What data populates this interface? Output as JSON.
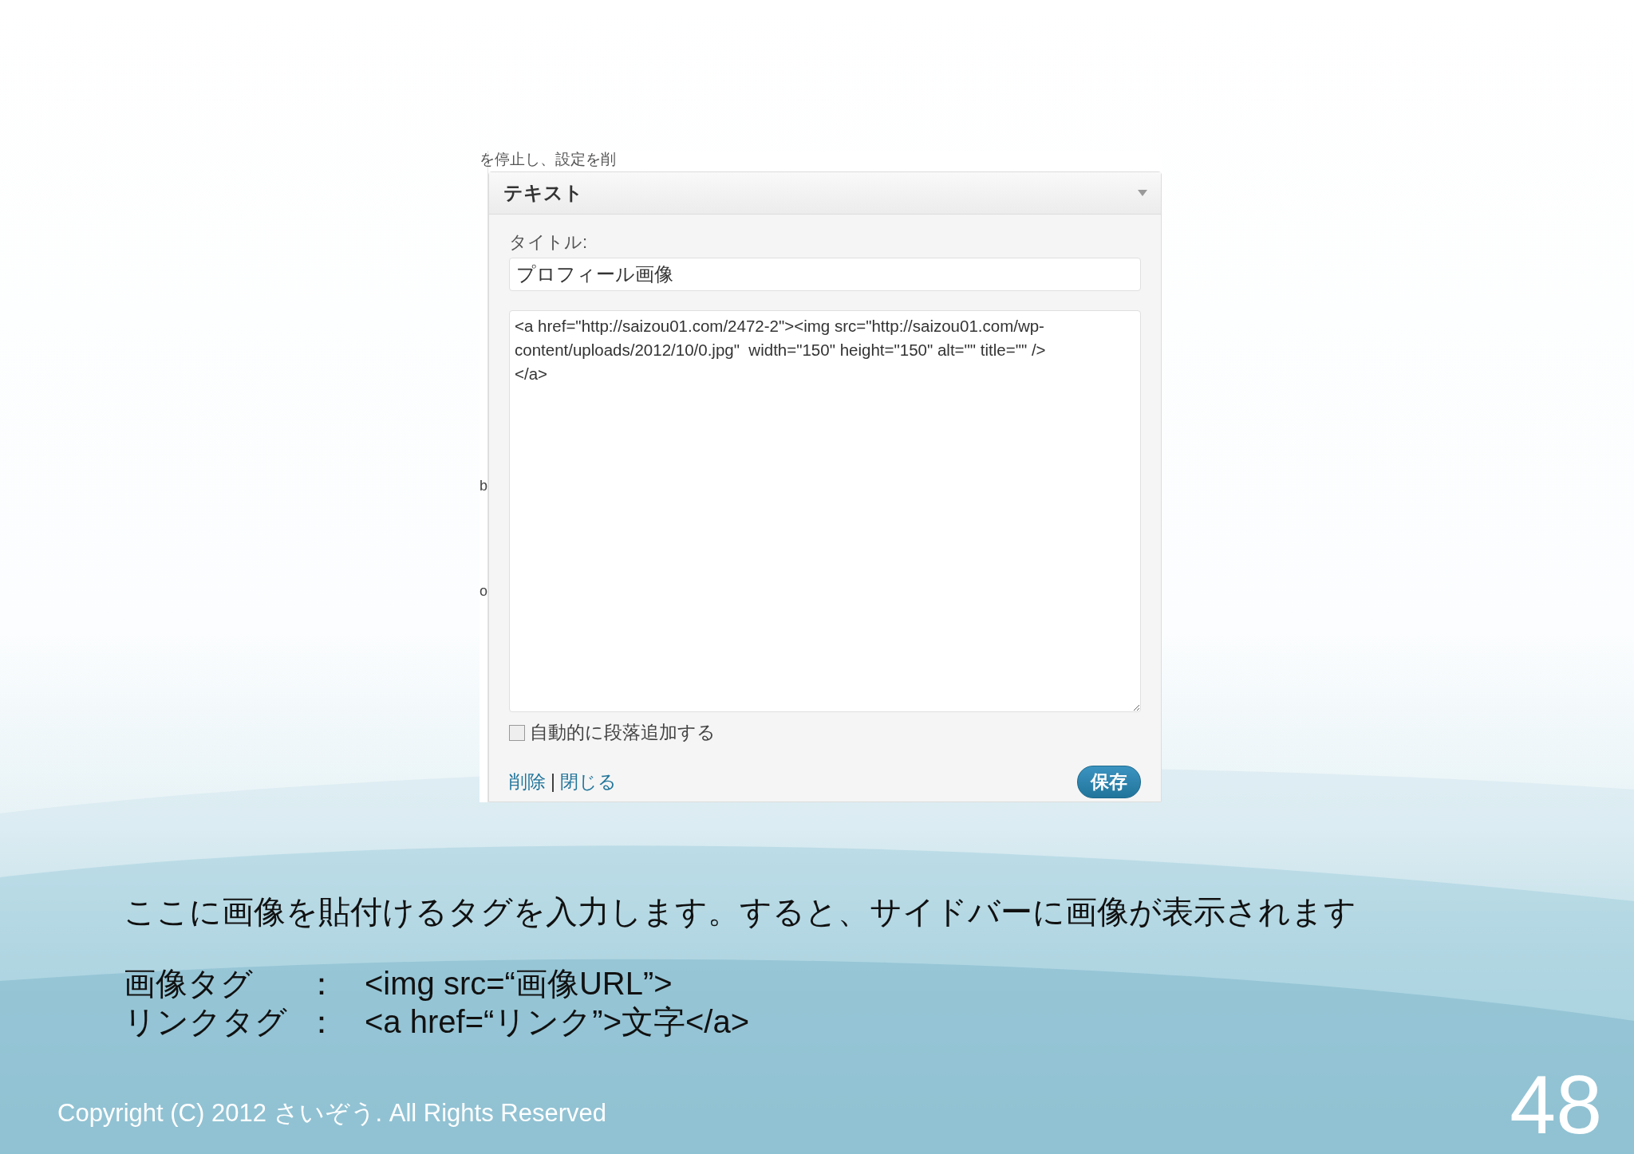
{
  "screenshot": {
    "background_text": "を停止し、設定を削",
    "edge_fragments": [
      "b",
      "o"
    ],
    "widget": {
      "title": "テキスト",
      "title_label": "タイトル:",
      "title_value": "プロフィール画像",
      "content": "<a href=\"http://saizou01.com/2472-2\"><img src=\"http://saizou01.com/wp-content/uploads/2012/10/0.jpg\"  width=\"150\" height=\"150\" alt=\"\" title=\"\" />\n</a>",
      "auto_paragraph": {
        "label": "自動的に段落追加する",
        "checked": false
      },
      "links": [
        "削除",
        "閉じる"
      ],
      "separator": "|",
      "save_button": "保存"
    }
  },
  "description": "ここに画像を貼付けるタグを入力します。すると、サイドバーに画像が表示されます",
  "tags": [
    {
      "label": "画像タグ",
      "colon": "：",
      "value": "<img src=“画像URL”>"
    },
    {
      "label": "リンクタグ",
      "colon": "：",
      "value": "<a href=“リンク”>文字</a>"
    }
  ],
  "footer": {
    "copyright": "Copyright (C) 2012 さいぞう. All Rights Reserved",
    "page_number": "48"
  }
}
